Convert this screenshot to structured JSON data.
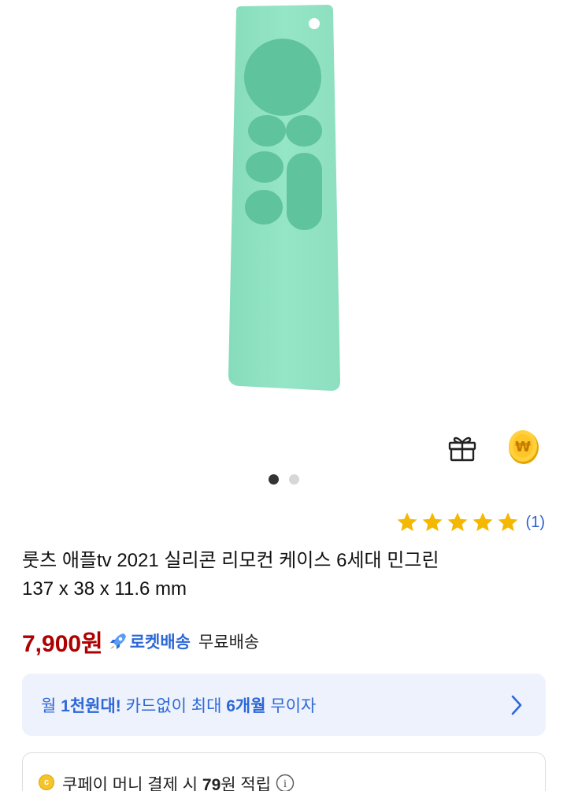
{
  "gallery": {
    "slides_total": 2,
    "active_index": 0,
    "product_color": "#92e3c5"
  },
  "icons": {
    "gift": "gift-icon",
    "cash": "won-coin-icon",
    "cash_symbol": "₩",
    "star": "star-icon",
    "rocket": "rocket-icon",
    "chevron": "chevron-right-icon",
    "info": "info-icon",
    "info_symbol": "i",
    "coupay_coin": "c-coin-icon",
    "coupay_symbol": "c"
  },
  "rating": {
    "stars": 5,
    "review_count": "(1)",
    "star_color": "#f5b800"
  },
  "product": {
    "title_line1": "룻츠 애플tv 2021 실리콘 리모컨 케이스 6세대 민그린",
    "title_line2": "137 x 38 x 11.6 mm"
  },
  "price": {
    "amount": "7,900원",
    "rocket_label": "로켓배송",
    "shipping": "무료배송",
    "price_color": "#ae0000",
    "rocket_color": "#2d68d8"
  },
  "installment": {
    "prefix": "월 ",
    "bold_amount": "1천원대!",
    "suffix": " 카드없이 최대 ",
    "bold_months": "6개월",
    "tail": " 무이자"
  },
  "coupay": {
    "prefix": "쿠페이 머니 결제 시 ",
    "bold_amount": "79",
    "suffix": "원 적립"
  }
}
